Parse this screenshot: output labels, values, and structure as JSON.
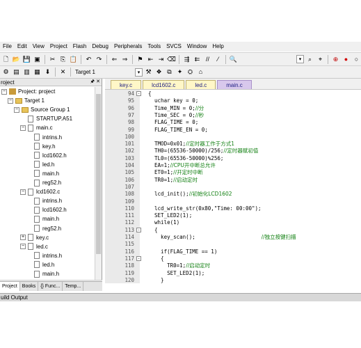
{
  "menu": [
    "File",
    "Edit",
    "View",
    "Project",
    "Flash",
    "Debug",
    "Peripherals",
    "Tools",
    "SVCS",
    "Window",
    "Help"
  ],
  "toolbar": {
    "target_name": "Target 1"
  },
  "project_panel": {
    "title": "roject",
    "tree": [
      {
        "label": "Project: project",
        "indent": 0,
        "type": "project",
        "expanded": true
      },
      {
        "label": "Target 1",
        "indent": 1,
        "type": "folder",
        "expanded": true
      },
      {
        "label": "Source Group 1",
        "indent": 2,
        "type": "folder",
        "expanded": true
      },
      {
        "label": "STARTUP.A51",
        "indent": 3,
        "type": "file"
      },
      {
        "label": "main.c",
        "indent": 3,
        "type": "file",
        "expanded": true
      },
      {
        "label": "intrins.h",
        "indent": 4,
        "type": "file"
      },
      {
        "label": "key.h",
        "indent": 4,
        "type": "file"
      },
      {
        "label": "lcd1602.h",
        "indent": 4,
        "type": "file"
      },
      {
        "label": "led.h",
        "indent": 4,
        "type": "file"
      },
      {
        "label": "main.h",
        "indent": 4,
        "type": "file"
      },
      {
        "label": "reg52.h",
        "indent": 4,
        "type": "file"
      },
      {
        "label": "lcd1602.c",
        "indent": 3,
        "type": "file",
        "expanded": true
      },
      {
        "label": "intrins.h",
        "indent": 4,
        "type": "file"
      },
      {
        "label": "lcd1602.h",
        "indent": 4,
        "type": "file"
      },
      {
        "label": "main.h",
        "indent": 4,
        "type": "file"
      },
      {
        "label": "reg52.h",
        "indent": 4,
        "type": "file"
      },
      {
        "label": "key.c",
        "indent": 3,
        "type": "file",
        "expanded": false
      },
      {
        "label": "led.c",
        "indent": 3,
        "type": "file",
        "expanded": true
      },
      {
        "label": "intrins.h",
        "indent": 4,
        "type": "file"
      },
      {
        "label": "led.h",
        "indent": 4,
        "type": "file"
      },
      {
        "label": "main.h",
        "indent": 4,
        "type": "file"
      }
    ],
    "tabs": [
      "Project",
      "Books",
      "{} Func...",
      "Temp..."
    ]
  },
  "editor": {
    "tabs": [
      "key.c",
      "lcd1602.c",
      "led.c",
      "main.c"
    ],
    "active_tab": "main.c",
    "lines": [
      {
        "num": "94",
        "fold": "-",
        "code": "{"
      },
      {
        "num": "95",
        "code": "  uchar key = 0;"
      },
      {
        "num": "96",
        "code": "  Time_MIN = 0;",
        "comment": "//分"
      },
      {
        "num": "97",
        "code": "  Time_SEC = 0;",
        "comment": "//秒"
      },
      {
        "num": "98",
        "code": "  FLAG_TIME = 0;"
      },
      {
        "num": "99",
        "code": "  FLAG_TIME_EN = 0;"
      },
      {
        "num": "100",
        "code": ""
      },
      {
        "num": "101",
        "code": "  TMOD=0x01;",
        "comment": "//定时器工作于方式1"
      },
      {
        "num": "102",
        "code": "  TH0=(65536-50000)/256;",
        "comment": "//定时器赋初值"
      },
      {
        "num": "103",
        "code": "  TL0=(65536-50000)%256;"
      },
      {
        "num": "104",
        "code": "  EA=1;",
        "comment": "//CPU开中断总允许"
      },
      {
        "num": "105",
        "code": "  ET0=1;",
        "comment": "//开定时中断"
      },
      {
        "num": "106",
        "code": "  TR0=1;",
        "comment": "//启动定时"
      },
      {
        "num": "107",
        "code": ""
      },
      {
        "num": "108",
        "code": "  lcd_init();",
        "comment": "//初始化LCD1602"
      },
      {
        "num": "109",
        "code": ""
      },
      {
        "num": "110",
        "code": "  lcd_write_str(0x80,\"Time: 00:00\");"
      },
      {
        "num": "111",
        "code": "  SET_LED2(1);"
      },
      {
        "num": "112",
        "code": "  while(1)"
      },
      {
        "num": "113",
        "fold": "-",
        "code": "  {"
      },
      {
        "num": "114",
        "code": "    key_scan();",
        "comment": "//独立按键扫描",
        "comment_pad": "                     "
      },
      {
        "num": "115",
        "code": ""
      },
      {
        "num": "116",
        "code": "    if(FLAG_TIME == 1)"
      },
      {
        "num": "117",
        "fold": "-",
        "code": "    {"
      },
      {
        "num": "118",
        "code": "      TR0=1;",
        "comment": "//启动定时"
      },
      {
        "num": "119",
        "code": "      SET_LED2(1);"
      },
      {
        "num": "120",
        "code": "    }"
      }
    ]
  },
  "output": {
    "title": "uild Output"
  }
}
